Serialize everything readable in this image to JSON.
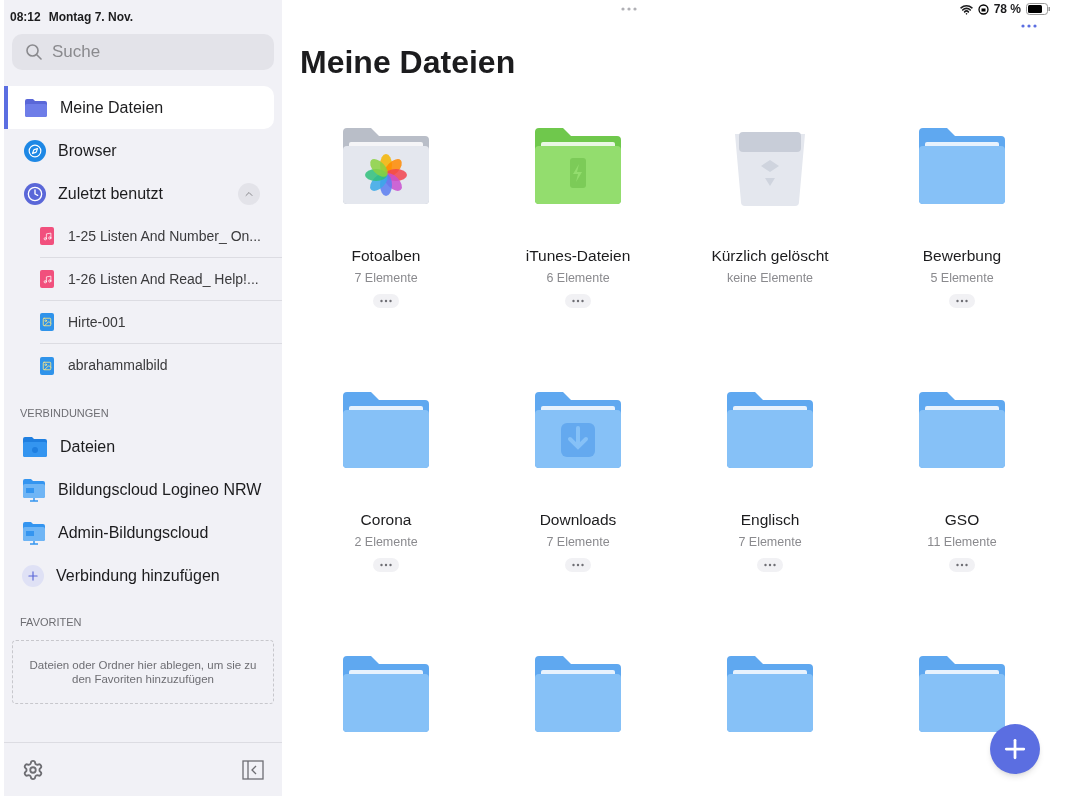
{
  "status_bar": {
    "time": "08:12",
    "date": "Montag 7. Nov.",
    "battery": "78 %"
  },
  "sidebar": {
    "search": {
      "placeholder": "Suche"
    },
    "nav": [
      {
        "kind": "folder",
        "label": "Meine Dateien",
        "selected": true
      },
      {
        "kind": "compass",
        "label": "Browser",
        "selected": false
      },
      {
        "kind": "clock",
        "label": "Zuletzt benutzt",
        "selected": false,
        "expanded": true,
        "children": [
          {
            "kind": "audio",
            "label": "1-25 Listen And Number_ On..."
          },
          {
            "kind": "audio",
            "label": "1-26 Listen And Read_ Help!..."
          },
          {
            "kind": "image",
            "label": "Hirte-001"
          },
          {
            "kind": "image",
            "label": "abrahammalbild"
          }
        ]
      }
    ],
    "connections": {
      "heading": "VERBINDUNGEN",
      "items": [
        {
          "kind": "icloud",
          "label": "Dateien"
        },
        {
          "kind": "dav",
          "label": "Bildungscloud Logineo NRW"
        },
        {
          "kind": "dav",
          "label": "Admin-Bildungscloud"
        },
        {
          "kind": "add",
          "label": "Verbindung hinzufügen"
        }
      ]
    },
    "favorites": {
      "heading": "FAVORITEN",
      "drop_hint": "Dateien oder Ordner hier ablegen, um sie zu den Favoriten hinzuzufügen"
    }
  },
  "main": {
    "title": "Meine Dateien",
    "folders": [
      {
        "kind": "photos",
        "name": "Fotoalben",
        "count": "7 Elemente",
        "menu": true
      },
      {
        "kind": "itunes",
        "name": "iTunes-Dateien",
        "count": "6 Elemente",
        "menu": true
      },
      {
        "kind": "trash",
        "name": "Kürzlich gelöscht",
        "count": "keine Elemente",
        "menu": false
      },
      {
        "kind": "plain",
        "name": "Bewerbung",
        "count": "5 Elemente",
        "menu": true
      },
      {
        "kind": "plain",
        "name": "Corona",
        "count": "2 Elemente",
        "menu": true
      },
      {
        "kind": "downloads",
        "name": "Downloads",
        "count": "7 Elemente",
        "menu": true
      },
      {
        "kind": "plain",
        "name": "Englisch",
        "count": "7 Elemente",
        "menu": true
      },
      {
        "kind": "plain",
        "name": "GSO",
        "count": "11 Elemente",
        "menu": true
      },
      {
        "kind": "plain",
        "menu": false
      },
      {
        "kind": "plain",
        "menu": false
      },
      {
        "kind": "plain",
        "menu": false
      },
      {
        "kind": "plain",
        "menu": false
      }
    ]
  }
}
